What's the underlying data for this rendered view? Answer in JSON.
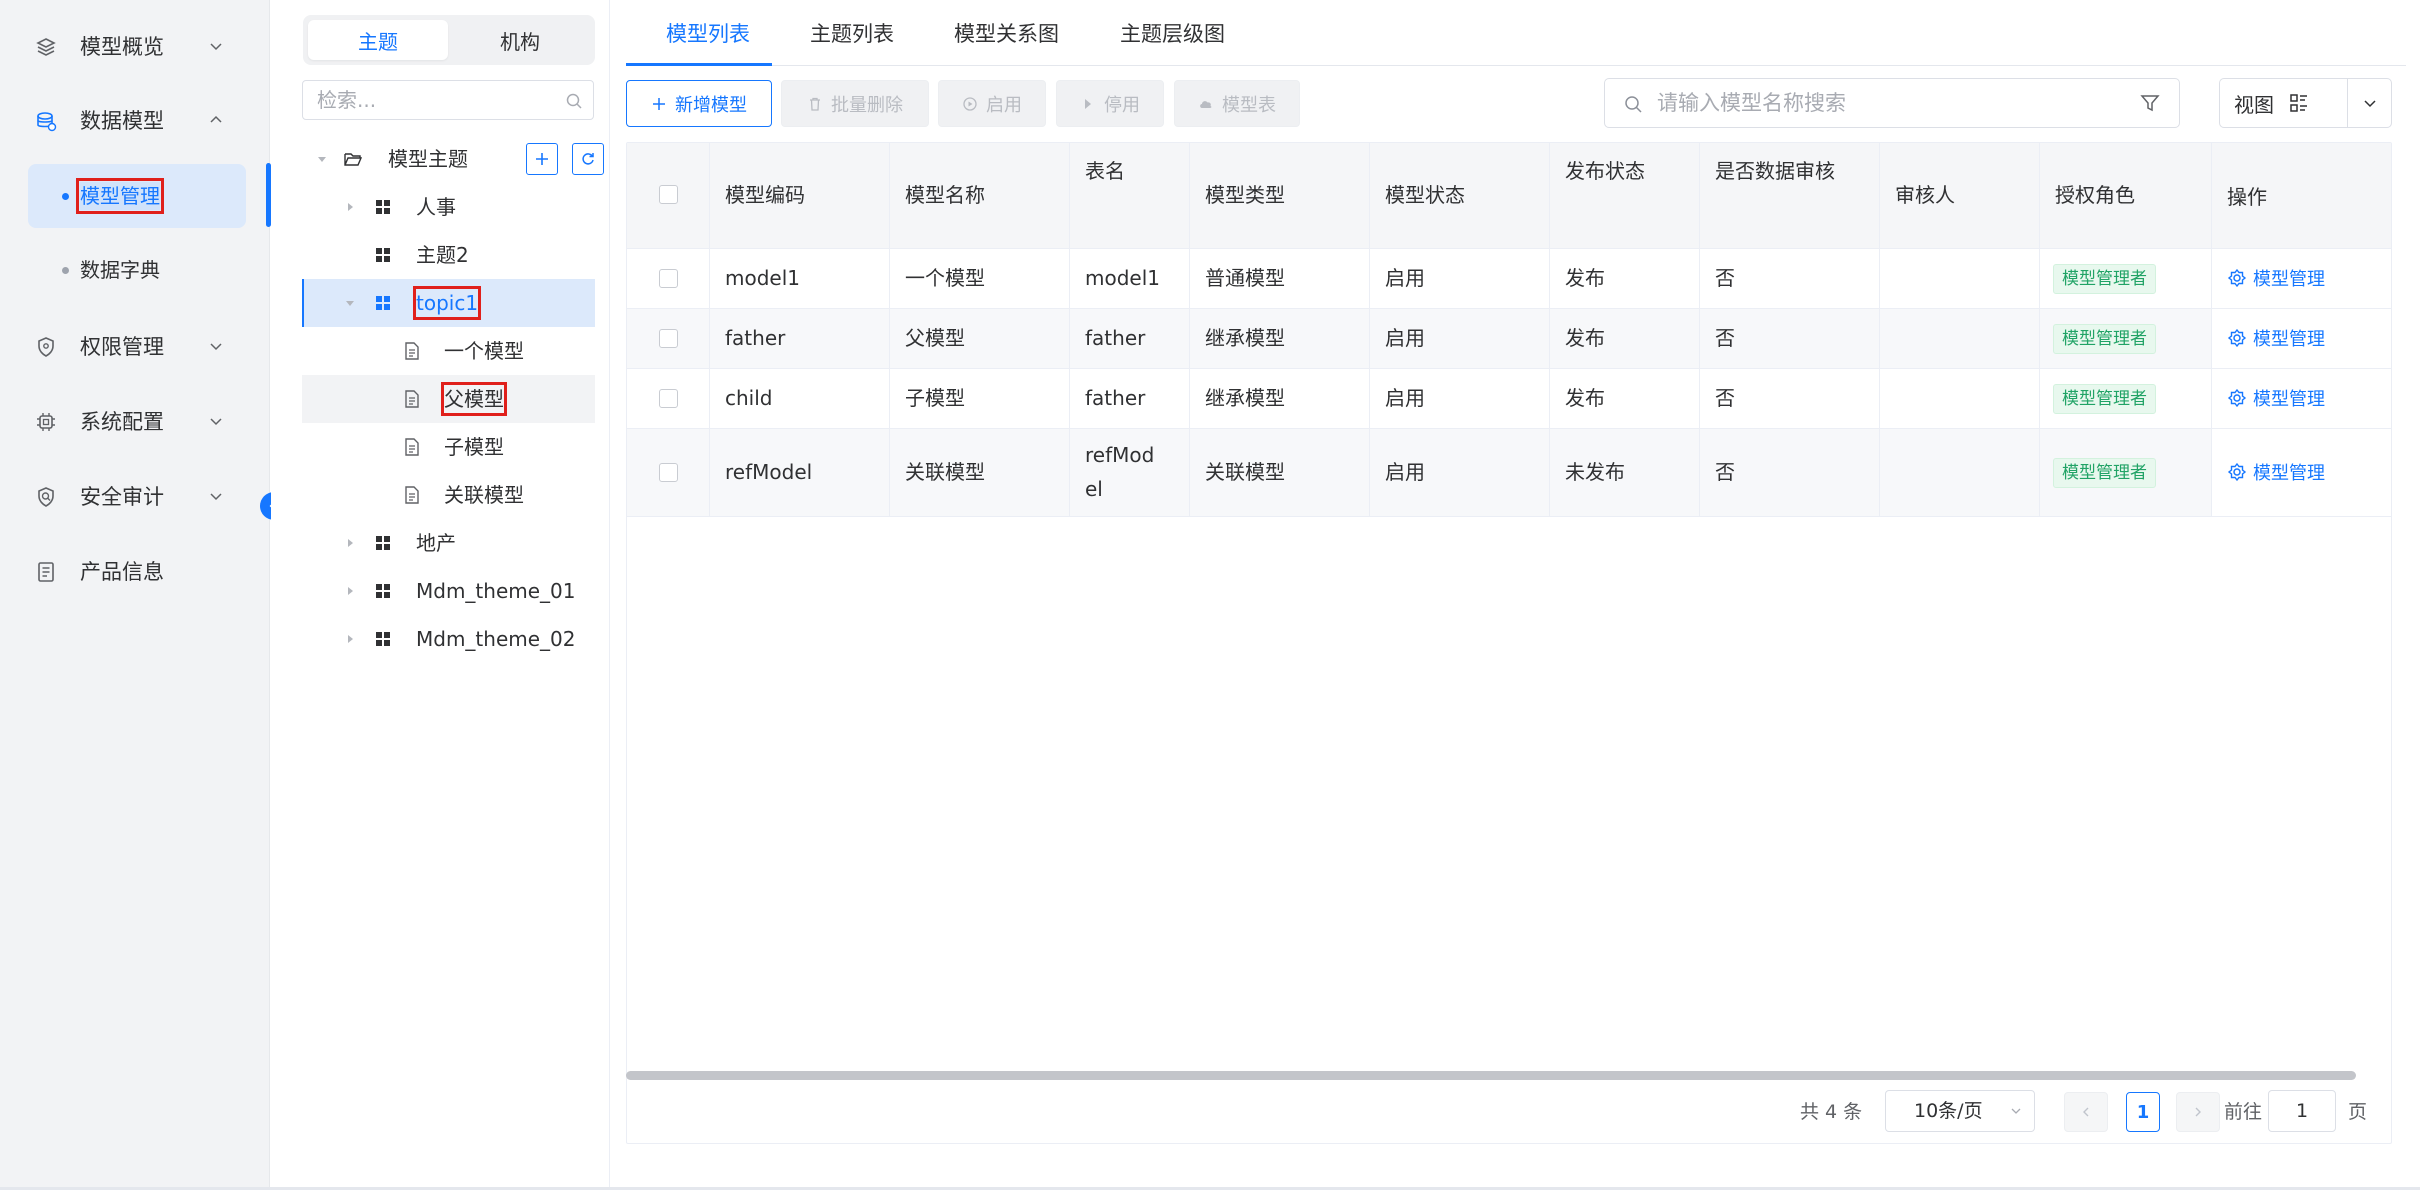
{
  "nav": {
    "items": [
      {
        "label": "模型概览",
        "icon": "layers-icon"
      },
      {
        "label": "数据模型",
        "icon": "database-icon"
      },
      {
        "label": "权限管理",
        "icon": "shield-icon"
      },
      {
        "label": "系统配置",
        "icon": "chip-icon"
      },
      {
        "label": "安全审计",
        "icon": "audit-shield-icon"
      },
      {
        "label": "产品信息",
        "icon": "document-icon"
      }
    ],
    "sub_items": [
      {
        "label": "模型管理",
        "active": true
      },
      {
        "label": "数据字典",
        "active": false
      }
    ]
  },
  "tree_panel": {
    "segments": [
      "主题",
      "机构"
    ],
    "active_segment": "主题",
    "search_placeholder": "检索...",
    "root_label": "模型主题",
    "nodes": [
      "人事",
      "主题2",
      "topic1",
      "一个模型",
      "父模型",
      "子模型",
      "关联模型",
      "地产",
      "Mdm_theme_01",
      "Mdm_theme_02"
    ],
    "selected_node": "topic1"
  },
  "tabs": [
    "模型列表",
    "主题列表",
    "模型关系图",
    "主题层级图"
  ],
  "active_tab": "模型列表",
  "toolbar": {
    "add": "新增模型",
    "batch_delete": "批量删除",
    "enable": "启用",
    "disable": "停用",
    "model_table": "模型表",
    "search_placeholder": "请输入模型名称搜索",
    "view": "视图"
  },
  "table": {
    "columns": [
      "模型编码",
      "模型名称",
      "表名",
      "模型类型",
      "模型状态",
      "发布状态",
      "是否数据审核",
      "审核人",
      "授权角色",
      "操作"
    ],
    "rows": [
      {
        "code": "model1",
        "name": "一个模型",
        "table": "model1",
        "type": "普通模型",
        "status": "启用",
        "publish": "发布",
        "audit": "否",
        "auditor": "",
        "role": "模型管理者",
        "op": "模型管理"
      },
      {
        "code": "father",
        "name": "父模型",
        "table": "father",
        "type": "继承模型",
        "status": "启用",
        "publish": "发布",
        "audit": "否",
        "auditor": "",
        "role": "模型管理者",
        "op": "模型管理"
      },
      {
        "code": "child",
        "name": "子模型",
        "table": "father",
        "type": "继承模型",
        "status": "启用",
        "publish": "发布",
        "audit": "否",
        "auditor": "",
        "role": "模型管理者",
        "op": "模型管理"
      },
      {
        "code": "refModel",
        "name": "关联模型",
        "table_line1": "refMod",
        "table_line2": "el",
        "type": "关联模型",
        "status": "启用",
        "publish": "未发布",
        "audit": "否",
        "auditor": "",
        "role": "模型管理者",
        "op": "模型管理"
      }
    ]
  },
  "pagination": {
    "total": "共 4 条",
    "page_size": "10条/页",
    "current_page": "1",
    "goto_label": "前往",
    "goto_value": "1",
    "page_suffix": "页"
  },
  "colors": {
    "accent": "#1677ff",
    "highlight": "#e0201b",
    "tag_green": "#21a366"
  }
}
